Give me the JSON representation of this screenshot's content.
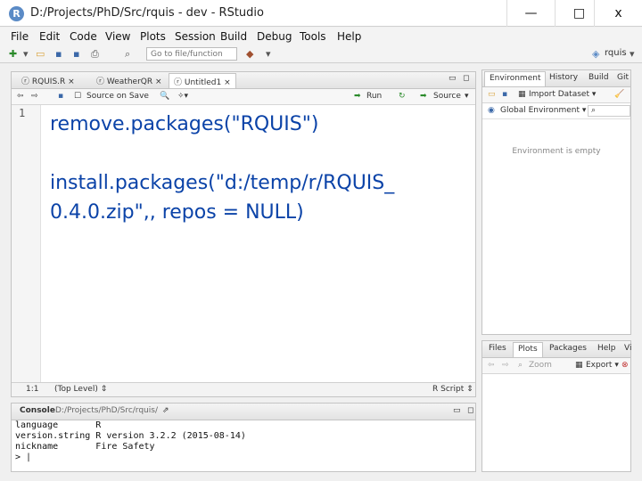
{
  "window": {
    "title": "D:/Projects/PhD/Src/rquis - dev - RStudio",
    "app_icon": "R",
    "minimize": "—",
    "maximize": "□",
    "close": "x"
  },
  "menu": [
    "File",
    "Edit",
    "Code",
    "View",
    "Plots",
    "Session",
    "Build",
    "Debug",
    "Tools",
    "Help"
  ],
  "toolbar": {
    "goto_placeholder": "Go to file/function",
    "project": "rquis"
  },
  "editor": {
    "tabs": [
      "RQUIS.R",
      "WeatherQR",
      "Untitled1"
    ],
    "active_tab": 2,
    "source_on_save": "Source on Save",
    "run": "Run",
    "source": "Source",
    "line_number": "1",
    "code_lines": [
      "remove.packages(\"RQUIS\")",
      "",
      "install.packages(\"d:/temp/r/RQUIS_",
      "0.4.0.zip\",, repos = NULL)"
    ],
    "position": "1:1",
    "scope": "(Top Level)",
    "filetype": "R Script"
  },
  "console": {
    "title": "Console",
    "path": "D:/Projects/PhD/Src/rquis/",
    "lines": [
      "language       R",
      "version.string R version 3.2.2 (2015-08-14)",
      "nickname       Fire Safety",
      "> "
    ]
  },
  "environment": {
    "tabs": [
      "Environment",
      "History",
      "Build",
      "Git"
    ],
    "import": "Import Dataset",
    "scope": "Global Environment",
    "empty_text": "Environment is empty"
  },
  "files": {
    "tabs": [
      "Files",
      "Plots",
      "Packages",
      "Help",
      "Viewer"
    ],
    "zoom": "Zoom",
    "export": "Export"
  }
}
